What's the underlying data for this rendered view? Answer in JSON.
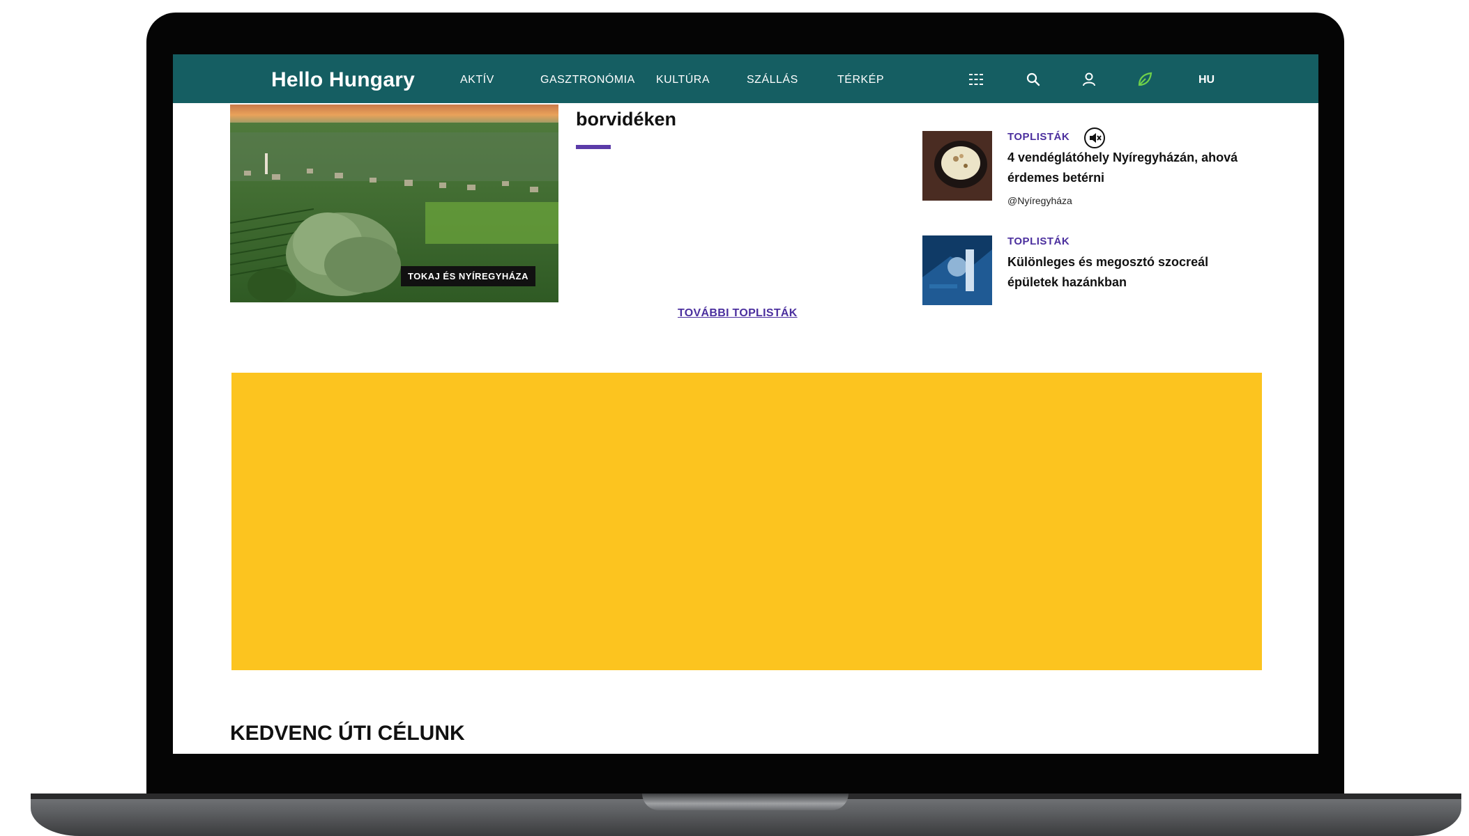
{
  "nav": {
    "logo": "Hello Hungary",
    "items": [
      "AKTÍV",
      "GASZTRONÓMIA",
      "KULTÚRA",
      "SZÁLLÁS",
      "TÉRKÉP"
    ],
    "language": "HU",
    "icons": [
      "grid-menu-icon",
      "search-icon",
      "user-icon",
      "leaf-icon"
    ],
    "bg_color": "#155e62"
  },
  "hero": {
    "tag": "TOKAJ ÉS NYÍREGYHÁZA",
    "title_fragment": "borvidéken",
    "accent_color": "#5b3ba8"
  },
  "more_link": "TOVÁBBI TOPLISTÁK",
  "sidebar": {
    "items": [
      {
        "category": "TOPLISTÁK",
        "title": "4 vendéglátóhely Nyíregyházán, ahová érdemes betérni",
        "source": "@Nyíregyháza"
      },
      {
        "category": "TOPLISTÁK",
        "title": "Különleges és megosztó szocreál épületek hazánkban"
      }
    ]
  },
  "ad": {
    "color": "#fcc41f"
  },
  "section": {
    "title": "KEDVENC ÚTI CÉLUNK"
  }
}
